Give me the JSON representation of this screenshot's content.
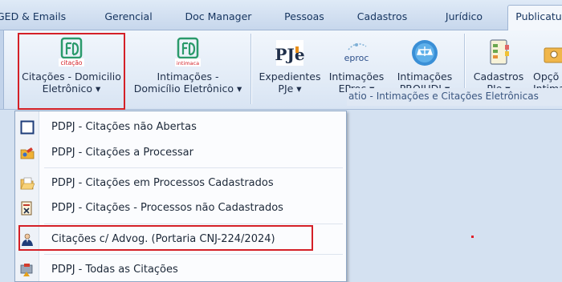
{
  "tabs": [
    {
      "label": "GED & Emails",
      "active": false
    },
    {
      "label": "Gerencial",
      "active": false
    },
    {
      "label": "Doc Manager",
      "active": false
    },
    {
      "label": "Pessoas",
      "active": false
    },
    {
      "label": "Cadastros",
      "active": false
    },
    {
      "label": "Jurídico",
      "active": false
    },
    {
      "label": "Publicatu",
      "active": true
    }
  ],
  "ribbon": {
    "buttons": [
      {
        "label1": "Citações - Domicilio",
        "label2": "Eletrônico ▾",
        "icon": "citacao-icon",
        "icon_caption": "citação"
      },
      {
        "label1": "Intimações -",
        "label2": "Domicílio Eletrônico ▾",
        "icon": "intimacao-icon",
        "icon_caption": "intimaca"
      },
      {
        "label1": "Expedientes",
        "label2": "PJe ▾",
        "icon": "pje-icon",
        "icon_text": "PJe"
      },
      {
        "label1": "Intimações",
        "label2": "EProc ▾",
        "icon": "eproc-icon",
        "icon_text": "eproc"
      },
      {
        "label1": "Intimações",
        "label2": "PROJUDI ▾",
        "icon": "projudi-icon"
      },
      {
        "label1": "Cadastros",
        "label2": "PJe ▾",
        "icon": "cadastros-icon"
      },
      {
        "label1": "Opçõ",
        "label2": "Intima",
        "icon": "options-icon"
      }
    ],
    "group_caption": "atio - Intimações e Citações Eletrônicas"
  },
  "menu": {
    "items": [
      {
        "label": "PDPJ - Citações não Abertas",
        "icon": "unopened-square-icon"
      },
      {
        "label": "PDPJ - Citações a Processar",
        "icon": "folder-process-icon"
      },
      {
        "label": "PDPJ - Citações em Processos Cadastrados",
        "icon": "folder-open-icon"
      },
      {
        "label": "PDPJ - Citações - Processos não Cadastrados",
        "icon": "document-x-icon"
      },
      {
        "label": "Citações c/ Advog. (Portaria CNJ-224/2024)",
        "icon": "lawyer-icon"
      },
      {
        "label": "PDPJ - Todas as Citações",
        "icon": "all-citations-icon"
      }
    ]
  },
  "colors": {
    "highlight_border": "#d42027",
    "ribbon_bg": "#e3ecf7",
    "tab_text": "#15345f"
  }
}
